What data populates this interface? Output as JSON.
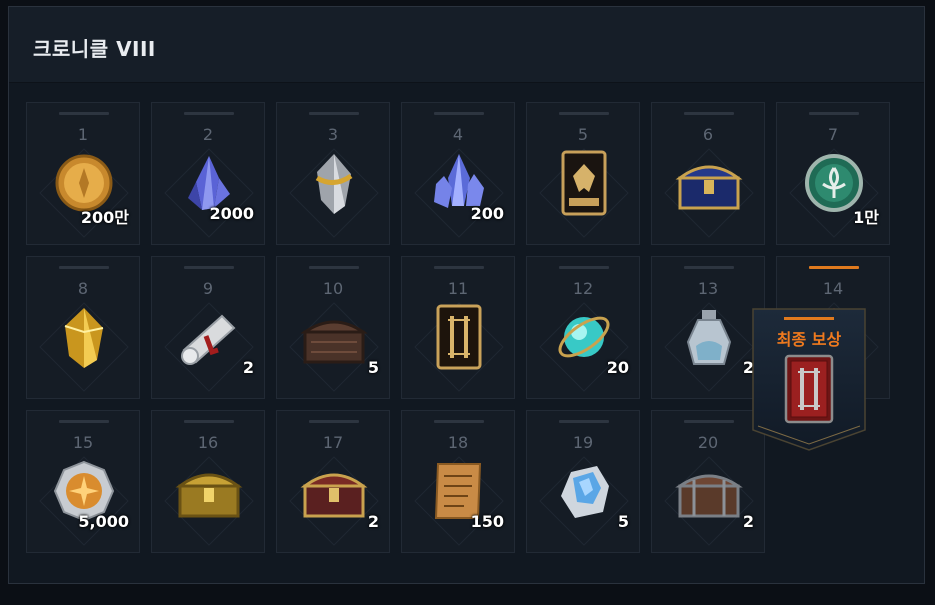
{
  "title": "크로니클 VIII",
  "rewards": [
    {
      "num": "1",
      "qty": "200만",
      "icon": "gold-coin-icon",
      "highlight": false
    },
    {
      "num": "2",
      "qty": "2000",
      "icon": "blue-crystal-icon",
      "highlight": false
    },
    {
      "num": "3",
      "qty": "",
      "icon": "silver-gold-stone-icon",
      "highlight": false
    },
    {
      "num": "4",
      "qty": "200",
      "icon": "blue-crystal-cluster-icon",
      "highlight": false
    },
    {
      "num": "5",
      "qty": "",
      "icon": "hero-card-icon",
      "highlight": false
    },
    {
      "num": "6",
      "qty": "",
      "icon": "blue-gold-chest-icon",
      "highlight": false
    },
    {
      "num": "7",
      "qty": "1만",
      "icon": "emerald-fleur-coin-icon",
      "highlight": false
    },
    {
      "num": "8",
      "qty": "",
      "icon": "gold-stone-icon",
      "highlight": false
    },
    {
      "num": "9",
      "qty": "2",
      "icon": "scroll-icon",
      "highlight": false
    },
    {
      "num": "10",
      "qty": "5",
      "icon": "dark-chest-icon",
      "highlight": false
    },
    {
      "num": "11",
      "qty": "",
      "icon": "gold-card-icon",
      "highlight": false
    },
    {
      "num": "12",
      "qty": "20",
      "icon": "cyan-orb-icon",
      "highlight": false
    },
    {
      "num": "13",
      "qty": "2",
      "icon": "potion-jar-icon",
      "highlight": false
    },
    {
      "num": "14",
      "qty": "",
      "icon": "red-gold-stone-icon",
      "highlight": true
    },
    {
      "num": "15",
      "qty": "5,000",
      "icon": "silver-star-coin-icon",
      "highlight": false
    },
    {
      "num": "16",
      "qty": "",
      "icon": "gold-chest-icon",
      "highlight": false
    },
    {
      "num": "17",
      "qty": "2",
      "icon": "red-gold-chest-icon",
      "highlight": false
    },
    {
      "num": "18",
      "qty": "150",
      "icon": "parchment-icon",
      "highlight": false
    },
    {
      "num": "19",
      "qty": "5",
      "icon": "crystal-ore-icon",
      "highlight": false
    },
    {
      "num": "20",
      "qty": "2",
      "icon": "iron-chest-icon",
      "highlight": false
    }
  ],
  "final_reward": {
    "label": "최종 보상",
    "icon": "red-card-icon"
  },
  "colors": {
    "accent": "#e07a1e",
    "bg": "#111821",
    "cell": "#151c25",
    "number": "#5d6673"
  }
}
